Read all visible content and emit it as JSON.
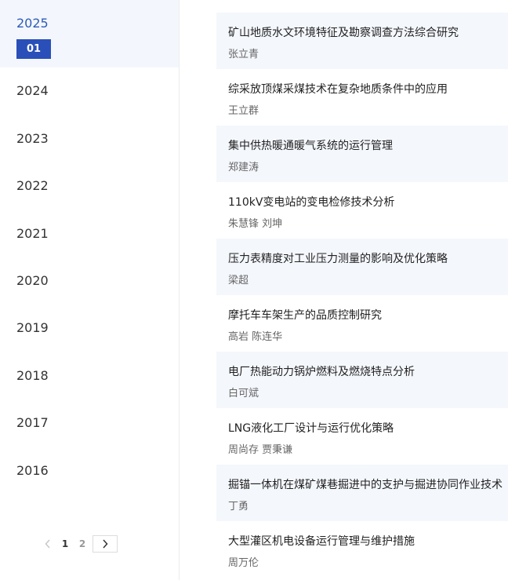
{
  "sidebar": {
    "active_year": "2025",
    "active_issue": "01",
    "years": [
      "2024",
      "2023",
      "2022",
      "2021",
      "2020",
      "2019",
      "2018",
      "2017",
      "2016"
    ],
    "pagination": {
      "pages": [
        "1",
        "2"
      ],
      "current": "1"
    }
  },
  "articles": [
    {
      "title": "矿山地质水文环境特征及勘察调查方法综合研究",
      "author": "张立青"
    },
    {
      "title": "综采放顶煤采煤技术在复杂地质条件中的应用",
      "author": "王立群"
    },
    {
      "title": "集中供热暖通暖气系统的运行管理",
      "author": "郑建涛"
    },
    {
      "title": "110kV变电站的变电检修技术分析",
      "author": "朱慧锋 刘坤"
    },
    {
      "title": "压力表精度对工业压力测量的影响及优化策略",
      "author": "梁超"
    },
    {
      "title": "摩托车车架生产的品质控制研究",
      "author": "高岩 陈连华"
    },
    {
      "title": "电厂热能动力锅炉燃料及燃烧特点分析",
      "author": "白可斌"
    },
    {
      "title": "LNG液化工厂设计与运行优化策略",
      "author": "周尚存 贾秉谦"
    },
    {
      "title": "掘锚一体机在煤矿煤巷掘进中的支护与掘进协同作业技术",
      "author": "丁勇"
    },
    {
      "title": "大型灌区机电设备运行管理与维护措施",
      "author": "周万伦"
    }
  ]
}
